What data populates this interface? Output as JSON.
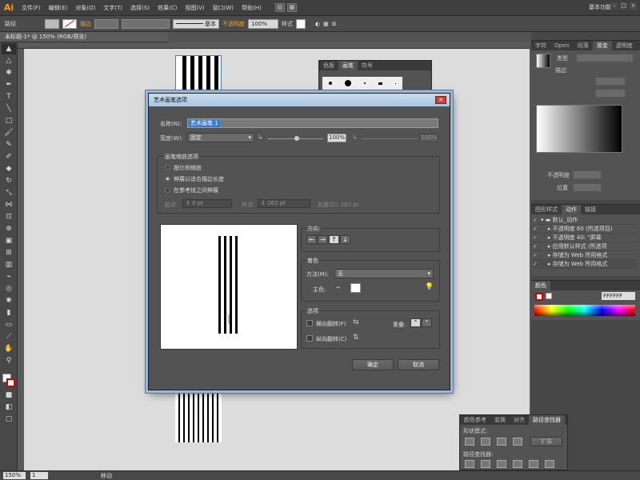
{
  "app": {
    "logo": "Ai",
    "menu": [
      "文件(F)",
      "编辑(E)",
      "对象(O)",
      "文字(T)",
      "选择(S)",
      "效果(C)",
      "视图(V)",
      "窗口(W)",
      "帮助(H)"
    ],
    "workspace": "基本功能",
    "window_buttons": [
      "–",
      "□",
      "×"
    ]
  },
  "control_bar": {
    "selection_label": "路径",
    "stroke_label": "描边",
    "stroke_profile": "基本",
    "opacity_label": "不透明度",
    "opacity_value": "100%",
    "style_label": "样式"
  },
  "document_tab": {
    "title": "未标题-1* @ 150% (RGB/预览)"
  },
  "status_bar": {
    "zoom": "150%",
    "artboard": "1",
    "tool_hint": "移动"
  },
  "brush_panel": {
    "tabs": [
      "色板",
      "画笔",
      "符号"
    ]
  },
  "right_panels": {
    "gradient_tabs": [
      "字符",
      "Open",
      "段落",
      "渐变",
      "透明度"
    ],
    "type_label": "类型",
    "stroke_label": "描边",
    "opacity_label": "不透明度",
    "location_label": "位置",
    "actions_tabs": [
      "图形样式",
      "动作",
      "链接"
    ],
    "actions": [
      "默认_动作",
      "不透明度 60 (所选项目)",
      "不透明度 40: \"屏幕",
      "应用默认样式 (所选项",
      "存储为 Web 所用格式",
      "存储为 Web 所用格式"
    ],
    "color_tab": "颜色",
    "color_hex": "FFFFFF"
  },
  "pathfinder": {
    "tabs": [
      "颜色参考",
      "变换",
      "对齐",
      "路径查找器"
    ],
    "shape_modes_label": "形状模式:",
    "expand_button": "扩展",
    "pathfinders_label": "路径查找器:"
  },
  "dialog": {
    "title": "艺术画笔选项",
    "name_label": "名称(N):",
    "name_value": "艺术画笔 1",
    "width_label": "宽度(W):",
    "width_value": "固定",
    "width_percent": "100%",
    "width_percent2": "100%",
    "scale_group_label": "画笔缩放选项",
    "radio_options": [
      "按比例缩放",
      "伸展以适合描边长度",
      "在参考线之间伸展"
    ],
    "start_label": "起点:",
    "start_value": "0 pt",
    "end_label": "终点:",
    "end_value": "262 pt",
    "length_label": "长度(Z): 262 pt",
    "direction_label": "方向:",
    "direction_buttons": [
      "←",
      "→",
      "↑",
      "↓"
    ],
    "colorization_label": "着色",
    "method_label": "方法(M):",
    "method_value": "无",
    "key_color_label": "主色:",
    "options_label": "选项",
    "flip_h_label": "横向翻转(F)",
    "flip_v_label": "纵向翻转(C)",
    "overlap_label": "重叠:",
    "ok_button": "确定",
    "cancel_button": "取消"
  }
}
